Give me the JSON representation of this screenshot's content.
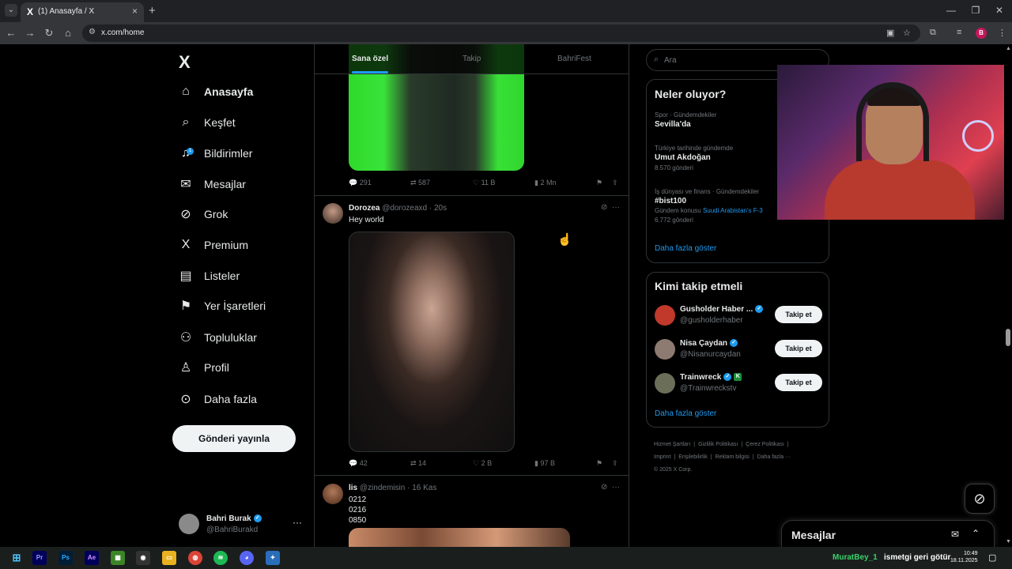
{
  "browser": {
    "tab_title": "(1) Anasayfa / X",
    "tab_favicon": "X",
    "url": "x.com/home",
    "profile_initial": "B"
  },
  "nav": {
    "logo": "X",
    "items": [
      {
        "label": "Anasayfa",
        "icon": "home-icon",
        "glyph": "⌂"
      },
      {
        "label": "Keşfet",
        "icon": "search-icon",
        "glyph": "⌕"
      },
      {
        "label": "Bildirimler",
        "icon": "bell-icon",
        "glyph": "♫",
        "badge": "1"
      },
      {
        "label": "Mesajlar",
        "icon": "envelope-icon",
        "glyph": "✉"
      },
      {
        "label": "Grok",
        "icon": "grok-icon",
        "glyph": "⊘"
      },
      {
        "label": "Premium",
        "icon": "x-premium-icon",
        "glyph": "X"
      },
      {
        "label": "Listeler",
        "icon": "list-icon",
        "glyph": "▤"
      },
      {
        "label": "Yer İşaretleri",
        "icon": "bookmark-icon",
        "glyph": "⚑"
      },
      {
        "label": "Topluluklar",
        "icon": "communities-icon",
        "glyph": "⚇"
      },
      {
        "label": "Profil",
        "icon": "person-icon",
        "glyph": "♙"
      },
      {
        "label": "Daha fazla",
        "icon": "more-circle-icon",
        "glyph": "⊙"
      }
    ],
    "post_button": "Gönderi yayınla"
  },
  "account": {
    "name": "Bahri Burak",
    "handle": "@BahriBurakd",
    "more": "···"
  },
  "feed": {
    "tabs": [
      "Sana özel",
      "Takip",
      "BahriFest"
    ],
    "tweet0_actions": {
      "replies": "291",
      "reposts": "587",
      "likes": "11 B",
      "views": "2 Mn"
    },
    "tweets": [
      {
        "name": "Dorozea",
        "handle": "@dorozeaxd",
        "time": "· 20s",
        "text": "Hey world",
        "actions": {
          "replies": "42",
          "reposts": "14",
          "likes": "2 B",
          "views": "97 B"
        }
      },
      {
        "name": "lis",
        "handle": "@zindemisin",
        "time": "· 16 Kas",
        "lines": [
          "0212",
          "0216",
          "0850"
        ]
      }
    ]
  },
  "right": {
    "search_placeholder": "Ara",
    "trends_title": "Neler oluyor?",
    "trends": [
      {
        "meta": "Spor · Gündemdekiler",
        "name": "Sevilla'da"
      },
      {
        "meta": "Türkiye tarihinde gündemde",
        "name": "Umut Akdoğan",
        "count": "8.570 gönderi"
      },
      {
        "meta": "İş dünyası ve finans · Gündemdekiler",
        "name": "#bist100",
        "context_prefix": "Gündem konusu",
        "context_link": "Suudi Arabistan's F-3",
        "count": "6.772 gönderi"
      }
    ],
    "trends_more": "Daha fazla göster",
    "who_title": "Kimi takip etmeli",
    "who": [
      {
        "name": "Gusholder Haber ...",
        "handle": "@gusholderhaber",
        "button": "Takip et",
        "avatar_color": "#c0392b"
      },
      {
        "name": "Nisa Çaydan",
        "handle": "@Nisanurcaydan",
        "button": "Takip et",
        "avatar_color": "#8d7a70"
      },
      {
        "name": "Trainwreck",
        "handle": "@Trainwreckstv",
        "button": "Takip et",
        "avatar_color": "#6b6f5a"
      }
    ],
    "who_more": "Daha fazla göster",
    "footer": {
      "links_row1": [
        "Hizmet Şartları",
        "|",
        "Gizlilik Politikası",
        "|",
        "Çerez Politikası",
        "|"
      ],
      "links_row2": [
        "Imprint",
        "|",
        "Erişilebilirlik",
        "|",
        "Reklam bilgisi",
        "|",
        "Daha fazla ···"
      ],
      "copyright": "© 2025 X Corp."
    }
  },
  "messages_drawer": {
    "title": "Mesajlar"
  },
  "taskbar": {
    "ticker_user": "MuratBey_1",
    "ticker_text": "ismetgi geri götür",
    "time": "10:49",
    "date": "18.11.2025"
  },
  "colors": {
    "accent": "#1d9bf0",
    "background": "#000000",
    "text": "#e7e9ea",
    "muted": "#71767b"
  }
}
